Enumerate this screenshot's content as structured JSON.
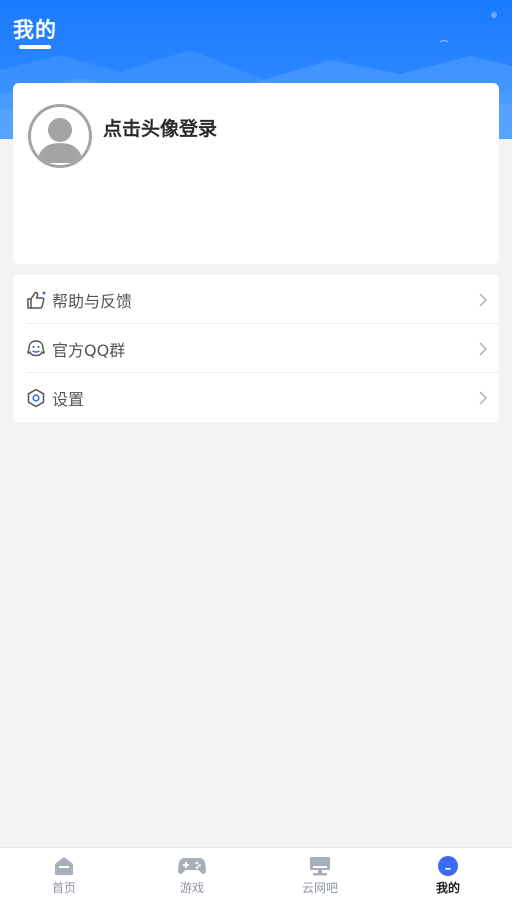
{
  "header": {
    "title": "我的",
    "gradient_colors": [
      "#1a7bff",
      "#3f95ff"
    ]
  },
  "profile": {
    "login_prompt": "点击头像登录",
    "avatar_icon": "default-avatar-icon"
  },
  "menu": {
    "items": [
      {
        "label": "帮助与反馈",
        "icon": "thumbs-up-icon"
      },
      {
        "label": "官方QQ群",
        "icon": "qq-penguin-icon"
      },
      {
        "label": "设置",
        "icon": "settings-hexagon-icon"
      }
    ]
  },
  "tabbar": {
    "active_color": "#3b6af5",
    "inactive_color": "#a9afb9",
    "tabs": [
      {
        "label": "首页",
        "icon": "home-icon",
        "active": false
      },
      {
        "label": "游戏",
        "icon": "gamepad-icon",
        "active": false
      },
      {
        "label": "云网吧",
        "icon": "computer-icon",
        "active": false
      },
      {
        "label": "我的",
        "icon": "profile-icon",
        "active": true
      }
    ]
  }
}
